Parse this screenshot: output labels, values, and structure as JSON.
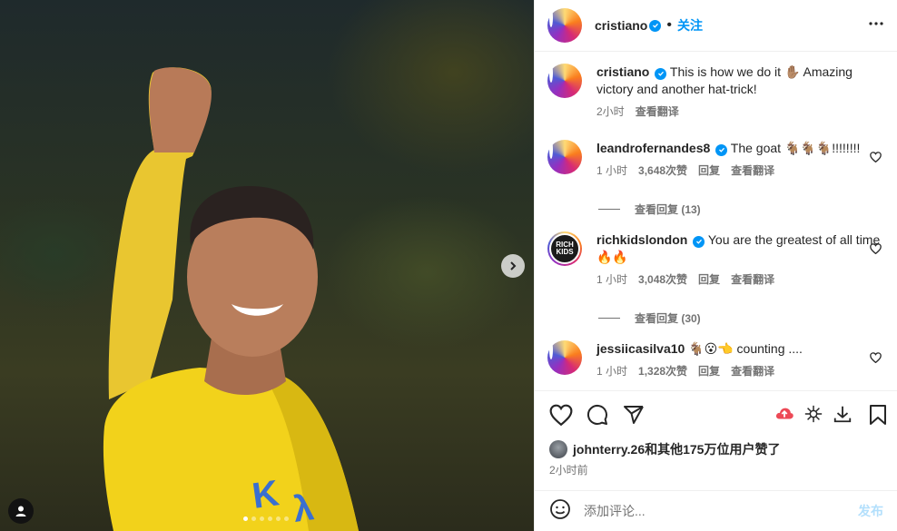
{
  "post": {
    "author": "cristiano",
    "follow_label": "关注",
    "separator": "•"
  },
  "caption": {
    "username": "cristiano",
    "text": "This is how we do it ✋🏽 Amazing victory and another hat-trick!",
    "time": "2小时",
    "translate": "查看翻译"
  },
  "comments": [
    {
      "username": "leandrofernandes8",
      "text": "The goat 🐐🐐🐐!!!!!!!!",
      "time": "1 小时",
      "likes": "3,648次赞",
      "reply": "回复",
      "translate": "查看翻译",
      "view_replies": "查看回复 (13)",
      "avatar_text": ""
    },
    {
      "username": "richkidslondon",
      "text": "You are the greatest of all time 🔥🔥",
      "time": "1 小时",
      "likes": "3,048次赞",
      "reply": "回复",
      "translate": "查看翻译",
      "view_replies": "查看回复 (30)",
      "avatar_text": "RICH KIDS"
    },
    {
      "username": "jessiicasilva10",
      "text": "🐐😮👈 counting ....",
      "time": "1 小时",
      "likes": "1,328次赞",
      "reply": "回复",
      "translate": "查看翻译",
      "view_replies": "",
      "avatar_text": ""
    }
  ],
  "liked_by": "johnterry.26和其他175万位用户赞了",
  "posted_ago": "2小时前",
  "add_comment": {
    "placeholder": "添加评论...",
    "post_label": "发布"
  },
  "carousel": {
    "slides": 6,
    "active": 0
  },
  "icons": [
    "more-icon",
    "verified-icon",
    "heart-icon",
    "comment-icon",
    "share-icon",
    "boost-icon",
    "threads-icon",
    "download-icon",
    "bookmark-icon",
    "emoji-icon",
    "next-arrow-icon",
    "user-tag-icon"
  ],
  "colors": {
    "accent": "#0095f6",
    "post_disabled": "#b2dffc",
    "muted": "#737373",
    "jersey": "#f2d21b"
  }
}
